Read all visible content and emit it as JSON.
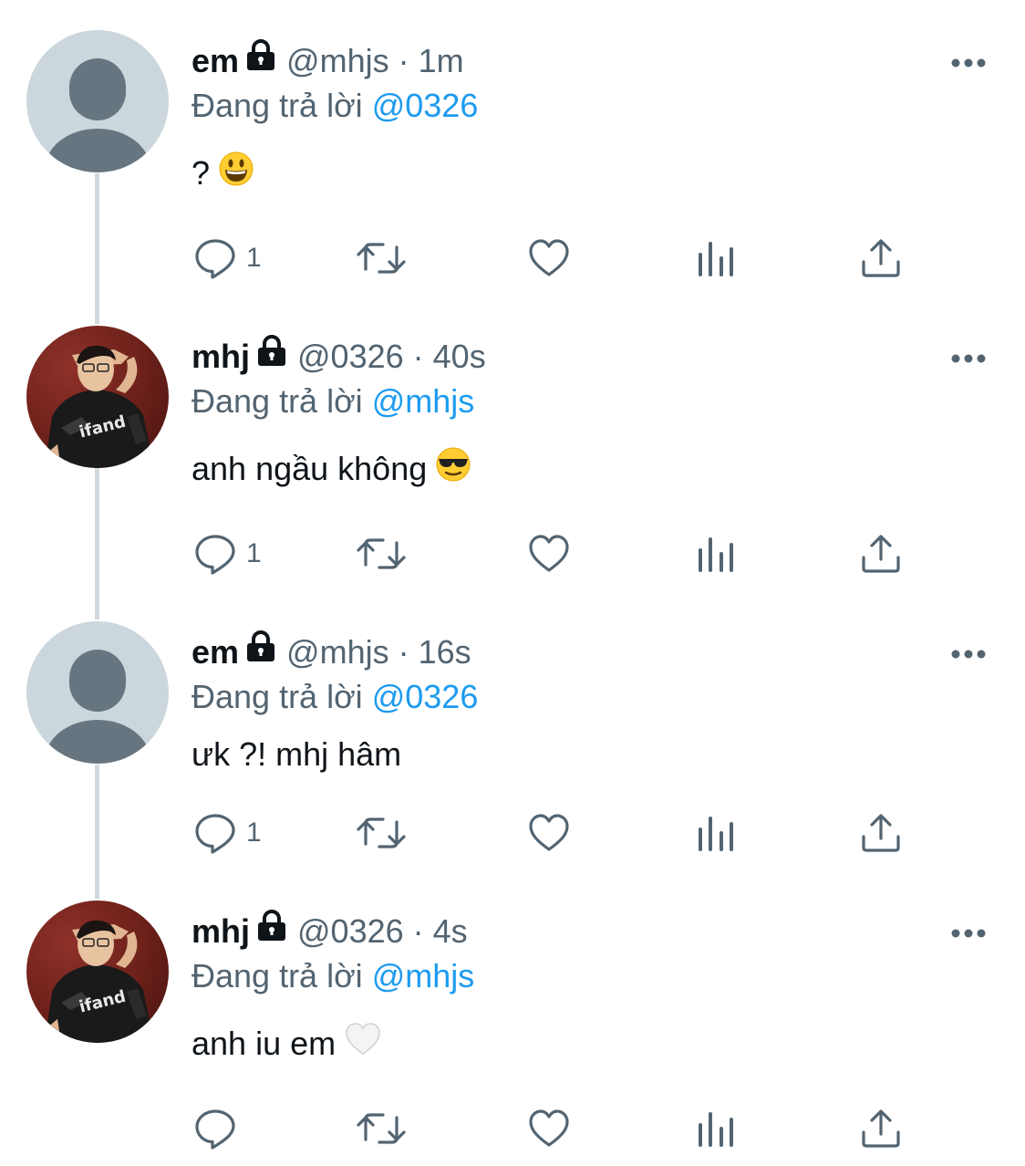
{
  "thread": [
    {
      "display_name": "em",
      "handle": "@mhjs",
      "separator": "·",
      "time": "1m",
      "reply_prefix": "Đang trả lời",
      "reply_to": "@0326",
      "text": "?",
      "emoji": "grinning-face",
      "avatar": "default-avatar",
      "reply_count": "1"
    },
    {
      "display_name": "mhj",
      "handle": "@0326",
      "separator": "·",
      "time": "40s",
      "reply_prefix": "Đang trả lời",
      "reply_to": "@mhjs",
      "text": "anh ngầu không",
      "emoji": "sunglasses-face",
      "avatar": "photo-avatar",
      "reply_count": "1"
    },
    {
      "display_name": "em",
      "handle": "@mhjs",
      "separator": "·",
      "time": "16s",
      "reply_prefix": "Đang trả lời",
      "reply_to": "@0326",
      "text": "ưk ?! mhj hâm",
      "emoji": "",
      "avatar": "default-avatar",
      "reply_count": "1"
    },
    {
      "display_name": "mhj",
      "handle": "@0326",
      "separator": "·",
      "time": "4s",
      "reply_prefix": "Đang trả lời",
      "reply_to": "@mhjs",
      "text": "anh iu em",
      "emoji": "white-heart",
      "avatar": "photo-avatar",
      "reply_count": ""
    }
  ],
  "icons": {
    "protected": "lock-icon",
    "more": "more-icon",
    "reply": "reply-icon",
    "retweet": "retweet-icon",
    "like": "like-icon",
    "views": "views-icon",
    "share": "share-icon"
  },
  "colors": {
    "text": "#0f1419",
    "secondary": "#536471",
    "link": "#1d9bf0",
    "thread_line": "#cfd9de",
    "default_avatar_bg": "#ccd6dd",
    "default_avatar_fg": "#66757f"
  }
}
